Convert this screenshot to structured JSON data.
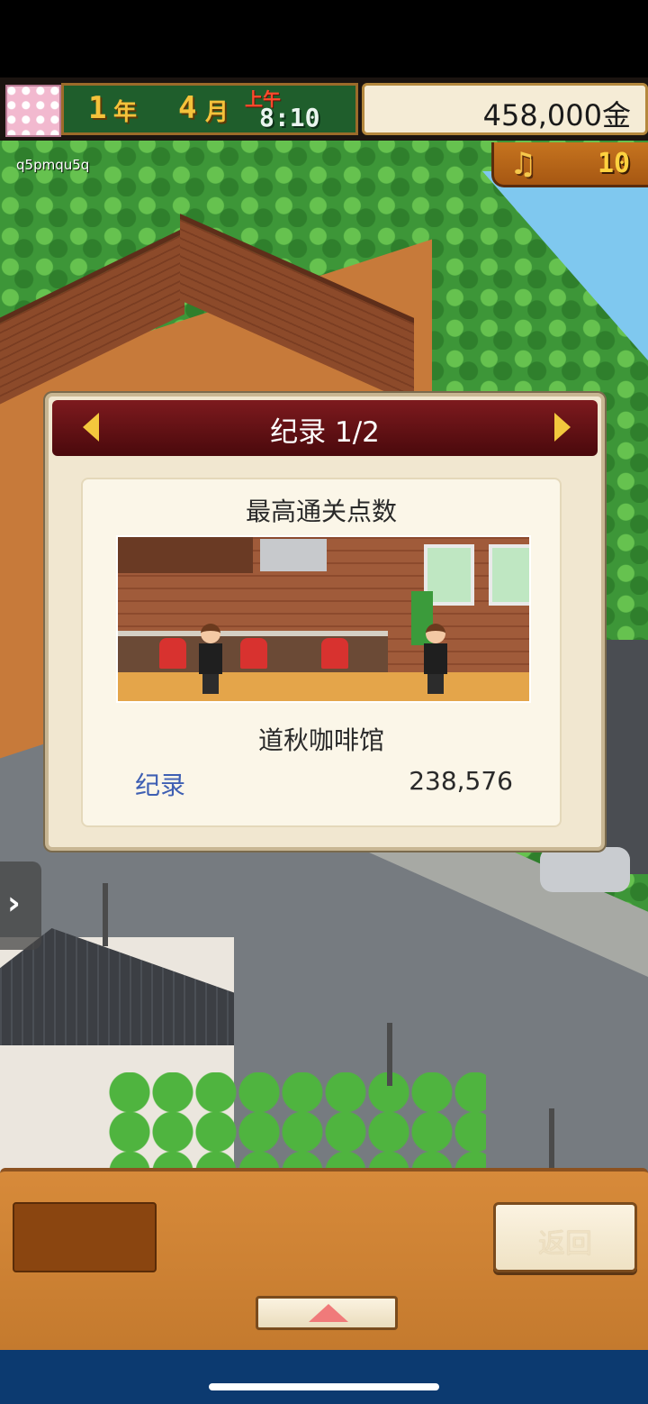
{
  "status_bar": {
    "year_num": "1",
    "year_unit": "年",
    "month_num": "4",
    "month_unit": "月",
    "period": "上午",
    "time": "8:10",
    "money": "458,000金",
    "music_count": "10",
    "music_icon": "music-note-icon"
  },
  "user_id": "q5pmqu5q",
  "dialog": {
    "title": "纪录 1/2",
    "prev_icon": "arrow-left-icon",
    "next_icon": "arrow-right-icon",
    "card_title": "最高通关点数",
    "cafe_name": "道秋咖啡馆",
    "record_label": "纪录",
    "record_value": "238,576"
  },
  "bottom": {
    "back_label": "返回",
    "up_icon": "triangle-up-icon"
  },
  "side_tab_icon": "chevron-right-icon",
  "colors": {
    "header_red": "#6b1418",
    "gold_text": "#f5c23b",
    "record_label_blue": "#3e5fb3",
    "panel_orange": "#d78a3a"
  }
}
